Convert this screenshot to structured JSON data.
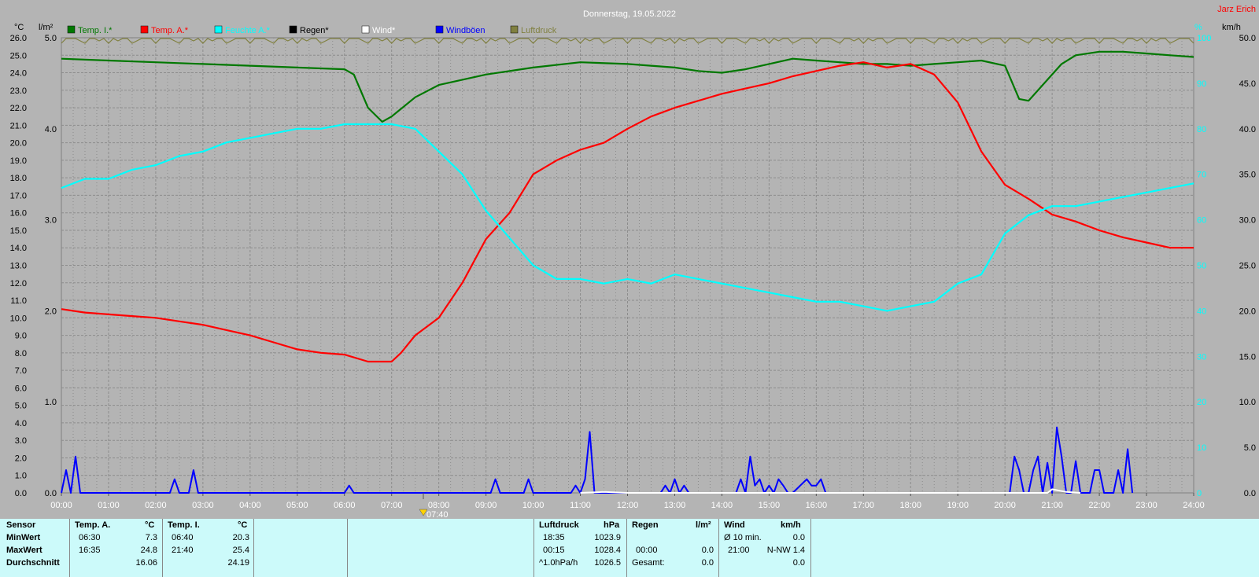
{
  "title": "Donnerstag, 19.05.2022",
  "author": "Jarz Erich",
  "left_unit": "°C",
  "left2_unit": "l/m²",
  "right_unit_pct": "%",
  "right_unit_kmh": "km/h",
  "marker_label": "07:40",
  "legend": [
    {
      "label": "Temp. I.*",
      "color": "#007800"
    },
    {
      "label": "Temp. A.*",
      "color": "#ff0000"
    },
    {
      "label": "Feuchte A.*",
      "color": "#00ffff"
    },
    {
      "label": "Regen*",
      "color": "#000000"
    },
    {
      "label": "Wind*",
      "color": "#ffffff"
    },
    {
      "label": "Windböen",
      "color": "#0000ff"
    },
    {
      "label": "Luftdruck",
      "color": "#808040"
    }
  ],
  "chart_data": {
    "type": "line",
    "title": "Donnerstag, 19.05.2022",
    "x_label": "Uhrzeit",
    "xlim": [
      0,
      24
    ],
    "x_ticks": [
      "00:00",
      "01:00",
      "02:00",
      "03:00",
      "04:00",
      "05:00",
      "06:00",
      "07:00",
      "08:00",
      "09:00",
      "10:00",
      "11:00",
      "12:00",
      "13:00",
      "14:00",
      "15:00",
      "16:00",
      "17:00",
      "18:00",
      "19:00",
      "20:00",
      "21:00",
      "22:00",
      "23:00",
      "24:00"
    ],
    "y_temp_ticks": [
      "0.0",
      "1.0",
      "2.0",
      "3.0",
      "4.0",
      "5.0",
      "6.0",
      "7.0",
      "8.0",
      "9.0",
      "10.0",
      "11.0",
      "12.0",
      "13.0",
      "14.0",
      "15.0",
      "16.0",
      "17.0",
      "18.0",
      "19.0",
      "20.0",
      "21.0",
      "22.0",
      "23.0",
      "24.0",
      "25.0",
      "26.0"
    ],
    "y_temp_lim": [
      0,
      26
    ],
    "y_rain_ticks": [
      "0.0",
      "1.0",
      "2.0",
      "3.0",
      "4.0",
      "5.0"
    ],
    "y_rain_lim": [
      0,
      5
    ],
    "y_pct_ticks": [
      "0",
      "10",
      "20",
      "30",
      "40",
      "50",
      "60",
      "70",
      "80",
      "90",
      "100"
    ],
    "y_pct_lim": [
      0,
      100
    ],
    "y_kmh_ticks": [
      "0.0",
      "5.0",
      "10.0",
      "15.0",
      "20.0",
      "25.0",
      "30.0",
      "35.0",
      "40.0",
      "45.0",
      "50.0"
    ],
    "y_kmh_lim": [
      0,
      50
    ],
    "grid": true,
    "series": [
      {
        "name": "Temp. I.*",
        "color": "#007800",
        "axis": "temp",
        "x": [
          0,
          1,
          2,
          3,
          4,
          5,
          6,
          6.2,
          6.5,
          6.8,
          7.0,
          7.5,
          8,
          9,
          10,
          11,
          12,
          13,
          13.5,
          14,
          14.5,
          15,
          15.5,
          16,
          16.5,
          17,
          17.5,
          18,
          18.5,
          19,
          19.5,
          20,
          20.3,
          20.5,
          20.8,
          21.2,
          21.5,
          22,
          22.5,
          23,
          23.5,
          24
        ],
        "y": [
          24.8,
          24.7,
          24.6,
          24.5,
          24.4,
          24.3,
          24.2,
          23.9,
          22.0,
          21.2,
          21.5,
          22.6,
          23.3,
          23.9,
          24.3,
          24.6,
          24.5,
          24.3,
          24.1,
          24.0,
          24.2,
          24.5,
          24.8,
          24.7,
          24.6,
          24.5,
          24.5,
          24.4,
          24.5,
          24.6,
          24.7,
          24.4,
          22.5,
          22.4,
          23.3,
          24.5,
          25.0,
          25.2,
          25.2,
          25.1,
          25.0,
          24.9
        ]
      },
      {
        "name": "Temp. A.*",
        "color": "#ff0000",
        "axis": "temp",
        "x": [
          0,
          0.5,
          1,
          1.5,
          2,
          2.5,
          3,
          3.5,
          4,
          4.5,
          5,
          5.5,
          6,
          6.5,
          7,
          7.2,
          7.5,
          8,
          8.5,
          9,
          9.5,
          10,
          10.5,
          11,
          11.5,
          12,
          12.5,
          13,
          13.5,
          14,
          14.5,
          15,
          15.5,
          16,
          16.5,
          17,
          17.5,
          18,
          18.5,
          19,
          19.5,
          20,
          20.5,
          21,
          21.5,
          22,
          22.5,
          23,
          23.5,
          24
        ],
        "y": [
          10.5,
          10.3,
          10.2,
          10.1,
          10.0,
          9.8,
          9.6,
          9.3,
          9.0,
          8.6,
          8.2,
          8.0,
          7.9,
          7.5,
          7.5,
          8.0,
          9.0,
          10.0,
          12.0,
          14.5,
          16.0,
          18.2,
          19.0,
          19.6,
          20.0,
          20.8,
          21.5,
          22.0,
          22.4,
          22.8,
          23.1,
          23.4,
          23.8,
          24.1,
          24.4,
          24.6,
          24.3,
          24.5,
          23.9,
          22.3,
          19.5,
          17.6,
          16.8,
          15.9,
          15.5,
          15.0,
          14.6,
          14.3,
          14.0,
          14.0
        ]
      },
      {
        "name": "Feuchte A.*",
        "color": "#00ffff",
        "axis": "pct",
        "x": [
          0,
          0.5,
          1,
          1.5,
          2,
          2.5,
          3,
          3.5,
          4,
          4.5,
          5,
          5.5,
          6,
          6.5,
          7,
          7.5,
          8,
          8.5,
          9,
          9.5,
          10,
          10.5,
          11,
          11.5,
          12,
          12.5,
          13,
          13.5,
          14,
          14.5,
          15,
          15.5,
          16,
          16.5,
          17,
          17.5,
          18,
          18.5,
          19,
          19.5,
          20,
          20.5,
          21,
          21.5,
          22,
          22.5,
          23,
          23.5,
          24
        ],
        "y": [
          67,
          69,
          69,
          71,
          72,
          74,
          75,
          77,
          78,
          79,
          80,
          80,
          81,
          81,
          81,
          80,
          75,
          70,
          62,
          56,
          50,
          47,
          47,
          46,
          47,
          46,
          48,
          47,
          46,
          45,
          44,
          43,
          42,
          42,
          41,
          40,
          41,
          42,
          46,
          48,
          57,
          61,
          63,
          63,
          64,
          65,
          66,
          67,
          68
        ]
      },
      {
        "name": "Windböen",
        "color": "#0000ff",
        "axis": "kmh",
        "x": [
          0,
          0.1,
          0.2,
          0.3,
          0.4,
          0.6,
          2.3,
          2.4,
          2.5,
          2.7,
          2.8,
          2.9,
          6.0,
          6.1,
          6.2,
          9.1,
          9.2,
          9.3,
          9.8,
          9.9,
          10.0,
          10.8,
          10.9,
          11.0,
          11.1,
          11.2,
          11.3,
          12.7,
          12.8,
          12.9,
          13.0,
          13.1,
          13.2,
          13.3,
          13.4,
          14.3,
          14.4,
          14.5,
          14.6,
          14.7,
          14.8,
          14.9,
          15.0,
          15.1,
          15.2,
          15.3,
          15.4,
          15.5,
          15.8,
          15.9,
          16.0,
          16.1,
          16.2,
          16.3,
          20.1,
          20.2,
          20.3,
          20.4,
          20.5,
          20.6,
          20.7,
          20.8,
          20.9,
          21.0,
          21.1,
          21.2,
          21.3,
          21.4,
          21.5,
          21.6,
          21.7,
          21.8,
          21.9,
          22.0,
          22.1,
          22.2,
          22.3,
          22.4,
          22.5,
          22.6,
          22.7
        ],
        "y": [
          0,
          2.5,
          0,
          4.0,
          0,
          0,
          0,
          1.5,
          0,
          0,
          2.5,
          0,
          0,
          0.8,
          0,
          0,
          1.5,
          0,
          0,
          1.5,
          0,
          0,
          0.8,
          0,
          1.5,
          6.7,
          0,
          0,
          0.8,
          0,
          1.5,
          0,
          0.8,
          0,
          0,
          0,
          1.5,
          0,
          4.0,
          0.8,
          1.5,
          0,
          0.8,
          0,
          1.5,
          0.8,
          0,
          0,
          1.5,
          0.8,
          0.8,
          1.5,
          0,
          0,
          0,
          4.0,
          2.5,
          0,
          0,
          2.5,
          4.0,
          0,
          3.3,
          0,
          7.2,
          4.0,
          0,
          0,
          3.5,
          0,
          0,
          0,
          2.5,
          2.5,
          0,
          0,
          0,
          2.5,
          0,
          4.8,
          0
        ]
      },
      {
        "name": "Wind*",
        "color": "#ffffff",
        "axis": "kmh",
        "x": [
          11.0,
          11.5,
          12.0,
          20.9,
          21.0,
          21.3,
          21.6
        ],
        "y": [
          0,
          0.1,
          0,
          0,
          0.4,
          0.1,
          0
        ]
      },
      {
        "name": "Luftdruck",
        "color": "#808040",
        "axis": "top",
        "note": "",
        "x": [
          0,
          24
        ],
        "y": [
          5,
          5
        ]
      }
    ]
  },
  "panel": {
    "sensor_header": "Sensor",
    "rows": [
      "MinWert",
      "MaxWert",
      "Durchschnitt"
    ],
    "temp_a": {
      "header": "Temp. A.",
      "unit": "°C",
      "min_time": "06:30",
      "min": "7.3",
      "max_time": "16:35",
      "max": "24.8",
      "avg": "16.06"
    },
    "temp_i": {
      "header": "Temp. I.",
      "unit": "°C",
      "min_time": "06:40",
      "min": "20.3",
      "max_time": "21:40",
      "max": "25.4",
      "avg": "24.19"
    },
    "luftdruck": {
      "header": "Luftdruck",
      "unit": "hPa",
      "min_time": "18:35",
      "min": "1023.9",
      "max_time": "00:15",
      "max": "1028.4",
      "trend_label": "^1.0hPa/h",
      "avg": "1026.5"
    },
    "regen": {
      "header": "Regen",
      "unit": "l/m²",
      "r1_time": "00:00",
      "r1": "0.0",
      "r2_label": "Gesamt:",
      "r2": "0.0"
    },
    "wind": {
      "header": "Wind",
      "unit": "km/h",
      "r0_label": "Ø 10 min.",
      "r0": "0.0",
      "r1_time": "21:00",
      "r1": "N-NW 1.4",
      "r2": "0.0"
    }
  }
}
